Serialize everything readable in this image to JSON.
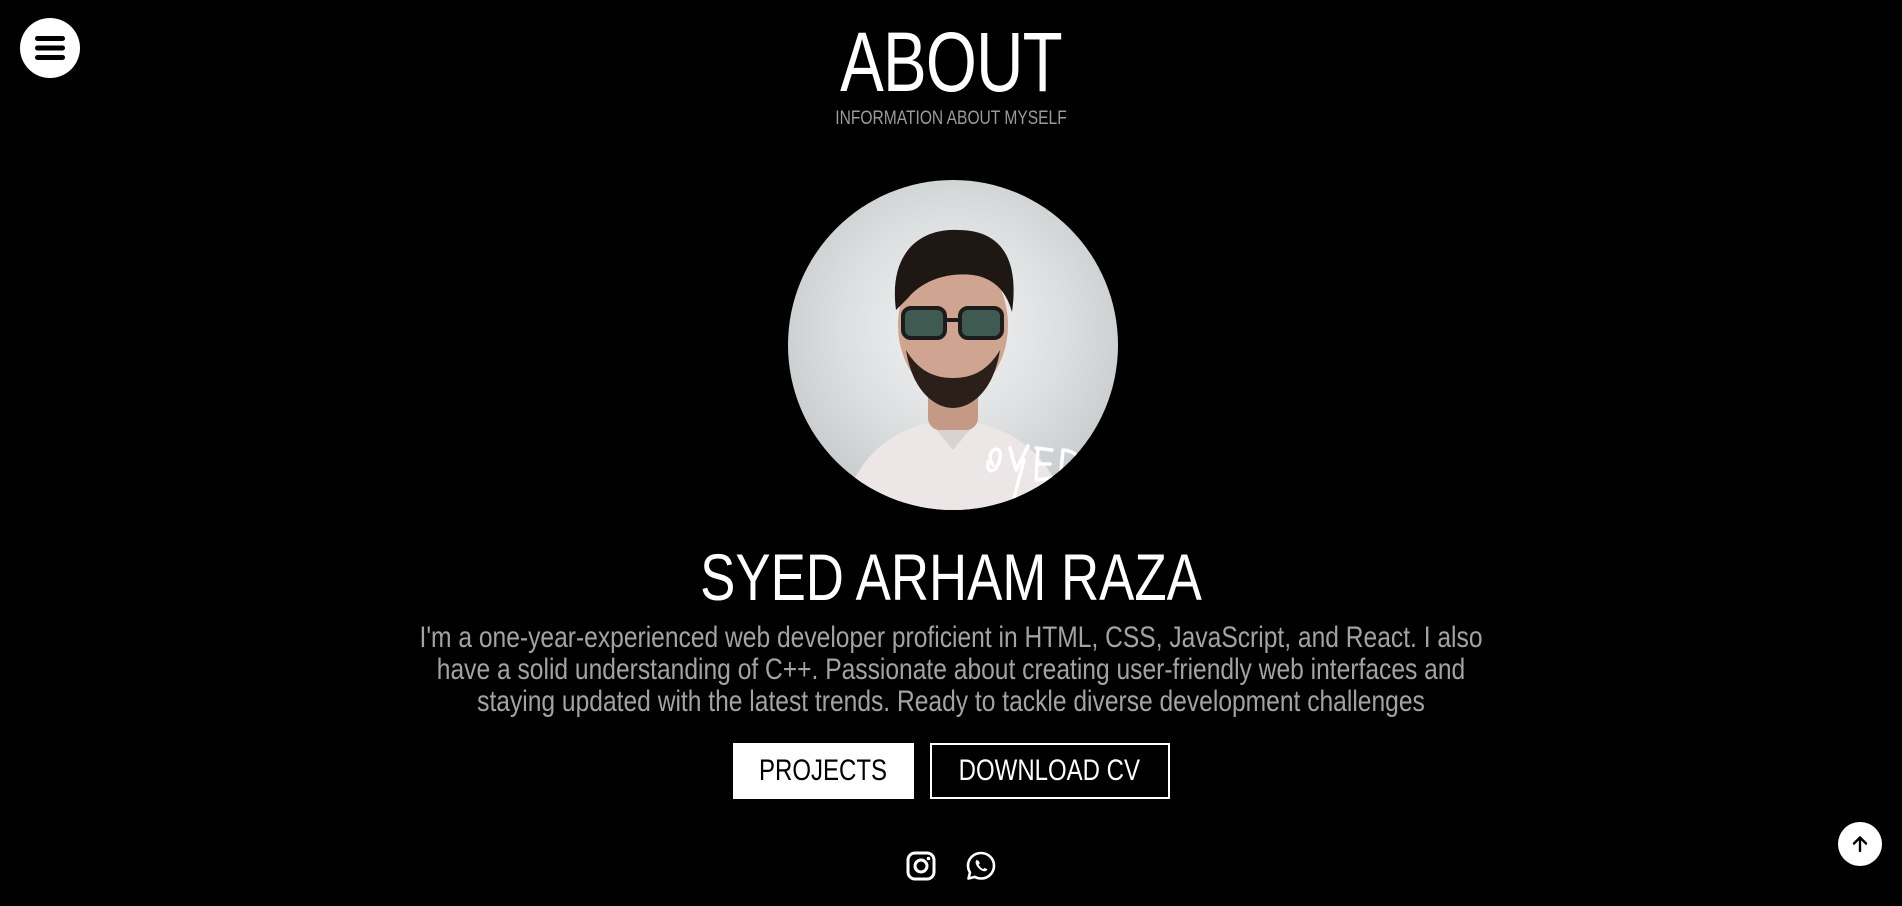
{
  "header": {
    "title": "ABOUT",
    "subtitle": "INFORMATION ABOUT MYSELF"
  },
  "menu": {
    "icon": "hamburger-menu-icon"
  },
  "profile": {
    "name": "SYED ARHAM RAZA",
    "photo_signature": "SYED",
    "bio": "I'm a one-year-experienced web developer proficient in HTML, CSS, JavaScript, and React. I also have a solid understanding of C++. Passionate about creating user-friendly web interfaces and staying updated with the latest trends. Ready to tackle diverse development challenges"
  },
  "actions": {
    "projects_label": "PROJECTS",
    "download_cv_label": "DOWNLOAD CV"
  },
  "socials": [
    {
      "icon": "instagram-icon"
    },
    {
      "icon": "whatsapp-icon"
    }
  ],
  "scroll_top": {
    "icon": "arrow-up-icon"
  },
  "colors": {
    "background": "#000000",
    "text": "#ffffff",
    "muted_text": "#9b9b9b"
  }
}
